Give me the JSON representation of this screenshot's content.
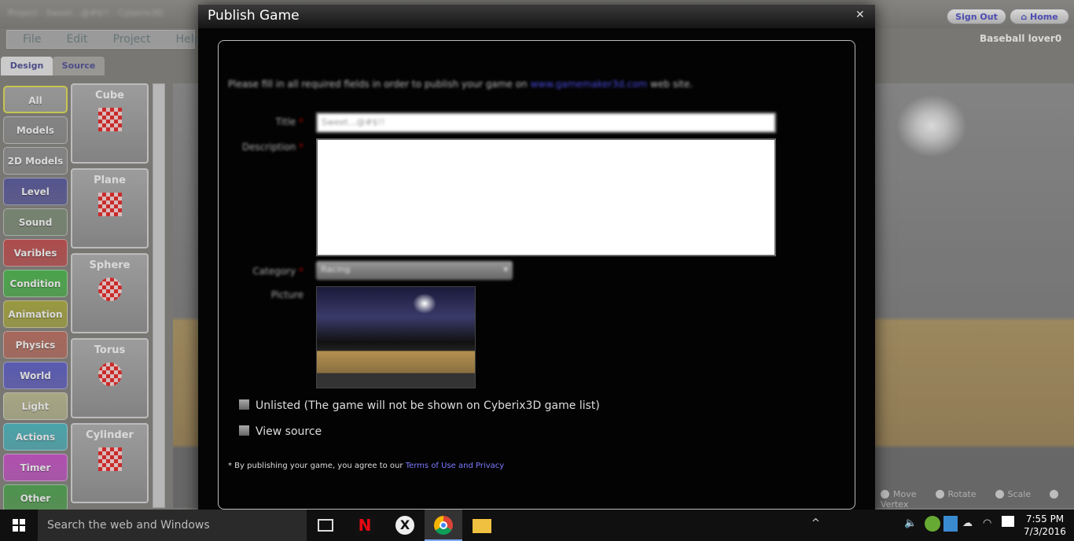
{
  "app": {
    "title_blurred": "Project - Sweet...@#$!! - Cyberix3D",
    "menu": [
      "File",
      "Edit",
      "Project",
      "Help"
    ],
    "tabs": [
      "Design",
      "Source"
    ],
    "sign_out": "Sign Out",
    "home": "Home",
    "user": "Baseball lover0"
  },
  "categories": [
    {
      "label": "All",
      "color": "#b0b0b0"
    },
    {
      "label": "Models",
      "color": "#9a9a9a"
    },
    {
      "label": "2D Models",
      "color": "#9a9a9a"
    },
    {
      "label": "Level",
      "color": "#6464a8"
    },
    {
      "label": "Sound",
      "color": "#8a9a84"
    },
    {
      "label": "Varibles",
      "color": "#cc5a5a"
    },
    {
      "label": "Condition",
      "color": "#58c058"
    },
    {
      "label": "Animation",
      "color": "#b4b44c"
    },
    {
      "label": "Physics",
      "color": "#c47a6c"
    },
    {
      "label": "World",
      "color": "#6a6ad0"
    },
    {
      "label": "Light",
      "color": "#c4c49c"
    },
    {
      "label": "Actions",
      "color": "#58c0c8"
    },
    {
      "label": "Timer",
      "color": "#d05ed0"
    },
    {
      "label": "Other",
      "color": "#5cae5c"
    }
  ],
  "items": [
    "Cube",
    "Plane",
    "Sphere",
    "Torus",
    "Cylinder"
  ],
  "transform_modes": [
    "Move",
    "Rotate",
    "Scale",
    "Vertex"
  ],
  "dialog": {
    "title": "Publish Game",
    "close": "✕",
    "intro_before": "Please fill in all required fields in order to publish your game on ",
    "intro_link": "www.gamemaker3d.com",
    "intro_after": " web site.",
    "title_label": "Title",
    "title_value": "Sweet...@#$!!",
    "description_label": "Description",
    "description_value": "",
    "category_label": "Category",
    "category_value": "Racing",
    "picture_label": "Picture",
    "unlisted": "Unlisted (The game will not be shown on Cyberix3D game list)",
    "view_source": "View source",
    "terms_before": "* By publishing your game, you agree to our ",
    "terms_link": "Terms of Use and Privacy"
  },
  "taskbar": {
    "search_placeholder": "Search the web and Windows",
    "time": "7:55 PM",
    "date": "7/3/2016"
  }
}
